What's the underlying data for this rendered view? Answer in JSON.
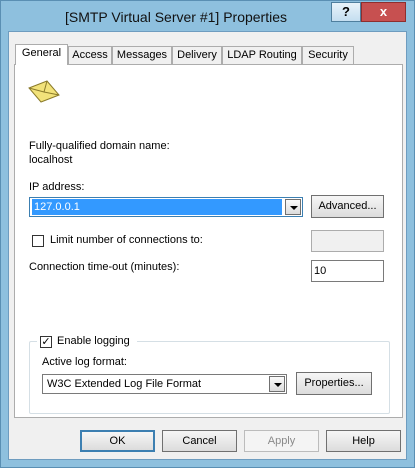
{
  "window": {
    "title": "[SMTP Virtual Server #1] Properties",
    "help_label": "?",
    "close_label": "x"
  },
  "tabs": [
    {
      "label": "General",
      "active": true
    },
    {
      "label": "Access",
      "active": false
    },
    {
      "label": "Messages",
      "active": false
    },
    {
      "label": "Delivery",
      "active": false
    },
    {
      "label": "LDAP Routing",
      "active": false
    },
    {
      "label": "Security",
      "active": false
    }
  ],
  "general": {
    "icon": "smtp-envelope-icon",
    "fqdn_label": "Fully-qualified domain name:",
    "fqdn_value": "localhost",
    "ip_label": "IP address:",
    "ip_value": "127.0.0.1",
    "advanced_label": "Advanced...",
    "limit_label": "Limit number of connections to:",
    "limit_checked": false,
    "limit_value": "",
    "timeout_label": "Connection time-out (minutes):",
    "timeout_value": "10",
    "logging_label": "Enable logging",
    "logging_checked": true,
    "log_format_label": "Active log format:",
    "log_format_value": "W3C Extended Log File Format",
    "properties_label": "Properties..."
  },
  "footer": {
    "ok_label": "OK",
    "cancel_label": "Cancel",
    "apply_label": "Apply",
    "help_label": "Help"
  },
  "colors": {
    "frame": "#8ec0de",
    "close_button": "#c75050",
    "selection": "#3399ff"
  }
}
